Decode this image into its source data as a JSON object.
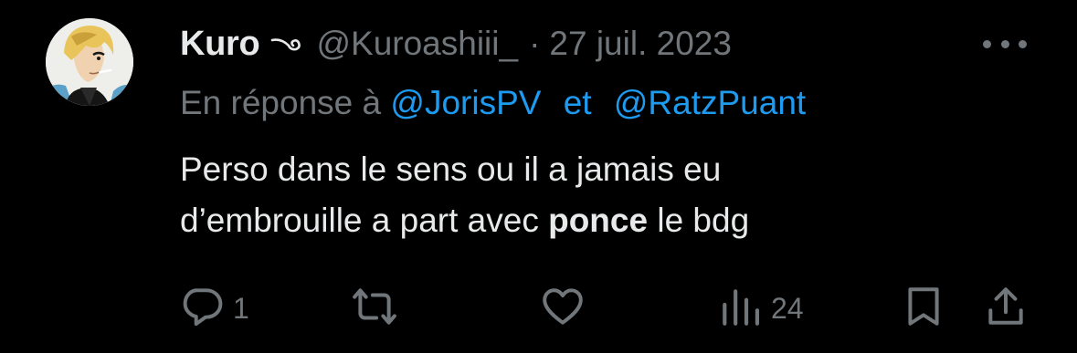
{
  "tweet": {
    "author_name": "Kuro",
    "handle": "@Kuroashiii_",
    "separator": "·",
    "date": "27 juil. 2023",
    "reply_prefix": "En réponse à",
    "mention_1": "@JorisPV",
    "conjunction": "et",
    "mention_2": "@RatzPuant",
    "text_line_1": "Perso dans le sens ou il a jamais eu",
    "text_line_2_before": "d’embrouille a part avec",
    "text_line_2_bold": "ponce",
    "text_line_2_after": "le bdg"
  },
  "actions": {
    "reply_count": "1",
    "retweet_count": "",
    "like_count": "",
    "views_count": "24"
  },
  "icons": {
    "more": "more-horizontal-icon",
    "reply": "reply-icon",
    "retweet": "retweet-icon",
    "like": "heart-icon",
    "views": "views-chart-icon",
    "bookmark": "bookmark-icon",
    "share": "share-icon",
    "name_emoji": "swirl-eyebrow-emoji"
  },
  "colors": {
    "background": "#000000",
    "primary_text": "#e7e9ea",
    "secondary_text": "#71767b",
    "accent": "#1d9bf0"
  }
}
